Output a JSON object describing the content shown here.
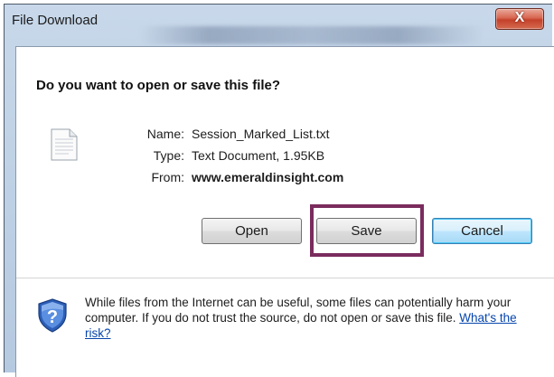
{
  "window": {
    "title": "File Download",
    "close_glyph": "X"
  },
  "dialog": {
    "question": "Do you want to open or save this file?",
    "file": {
      "name_label": "Name:",
      "name_value": "Session_Marked_List.txt",
      "type_label": "Type:",
      "type_value": "Text Document, 1.95KB",
      "from_label": "From:",
      "from_value": "www.emeraldinsight.com"
    },
    "buttons": {
      "open": "Open",
      "save": "Save",
      "cancel": "Cancel"
    },
    "warning": {
      "text": "While files from the Internet can be useful, some files can potentially harm your computer. If you do not trust the source, do not open or save this file. ",
      "link": "What's the risk?"
    }
  },
  "colors": {
    "highlight": "#7b2c5d",
    "close_button": "#c4412a",
    "link": "#0645ad",
    "shield": "#2d5fb8"
  },
  "icons": [
    "document-icon",
    "security-shield-icon",
    "close-icon"
  ]
}
